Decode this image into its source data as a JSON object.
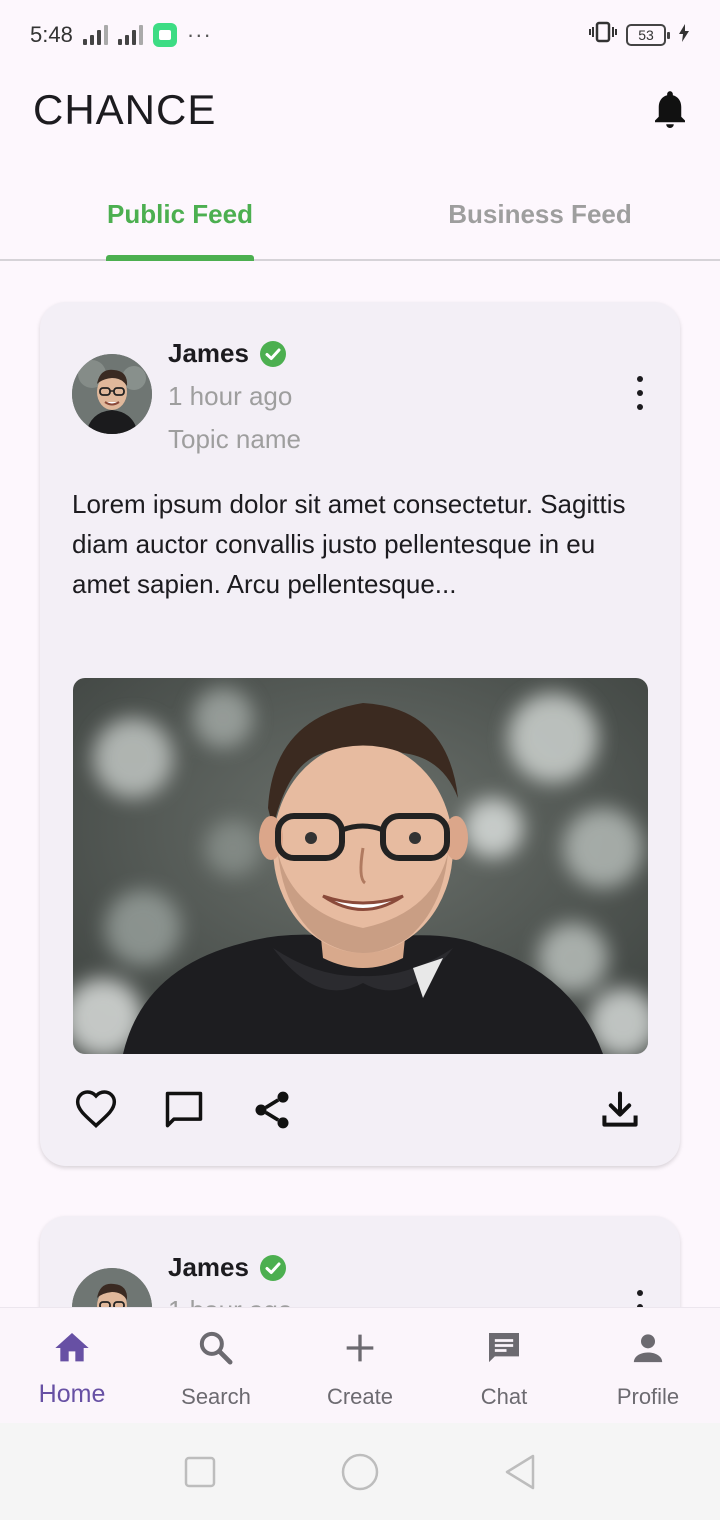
{
  "status_bar": {
    "time": "5:48",
    "battery": "53",
    "more_dots": "···"
  },
  "app_bar": {
    "title": "CHANCE",
    "notification_icon": "bell-icon"
  },
  "tabs": [
    {
      "label": "Public Feed",
      "active": true
    },
    {
      "label": "Business Feed",
      "active": false
    }
  ],
  "posts": [
    {
      "author": "James",
      "verified": true,
      "time": "1 hour ago",
      "topic": "Topic name",
      "text": "Lorem ipsum dolor sit amet consectetur. Sagittis diam auctor convallis justo pellentesque in eu amet sapien. Arcu pellentesque...",
      "actions": [
        "heart-icon",
        "comment-icon",
        "share-icon",
        "download-icon"
      ]
    },
    {
      "author": "James",
      "verified": true,
      "time": "1 hour ago"
    }
  ],
  "bottom_nav": [
    {
      "label": "Home",
      "icon": "home-icon",
      "active": true
    },
    {
      "label": "Search",
      "icon": "search-icon",
      "active": false
    },
    {
      "label": "Create",
      "icon": "plus-icon",
      "active": false
    },
    {
      "label": "Chat",
      "icon": "chat-icon",
      "active": false
    },
    {
      "label": "Profile",
      "icon": "person-icon",
      "active": false
    }
  ],
  "colors": {
    "accent_green": "#4caf50",
    "nav_active": "#6750a4",
    "background": "#fdf7fd",
    "card": "#f3eff6"
  }
}
